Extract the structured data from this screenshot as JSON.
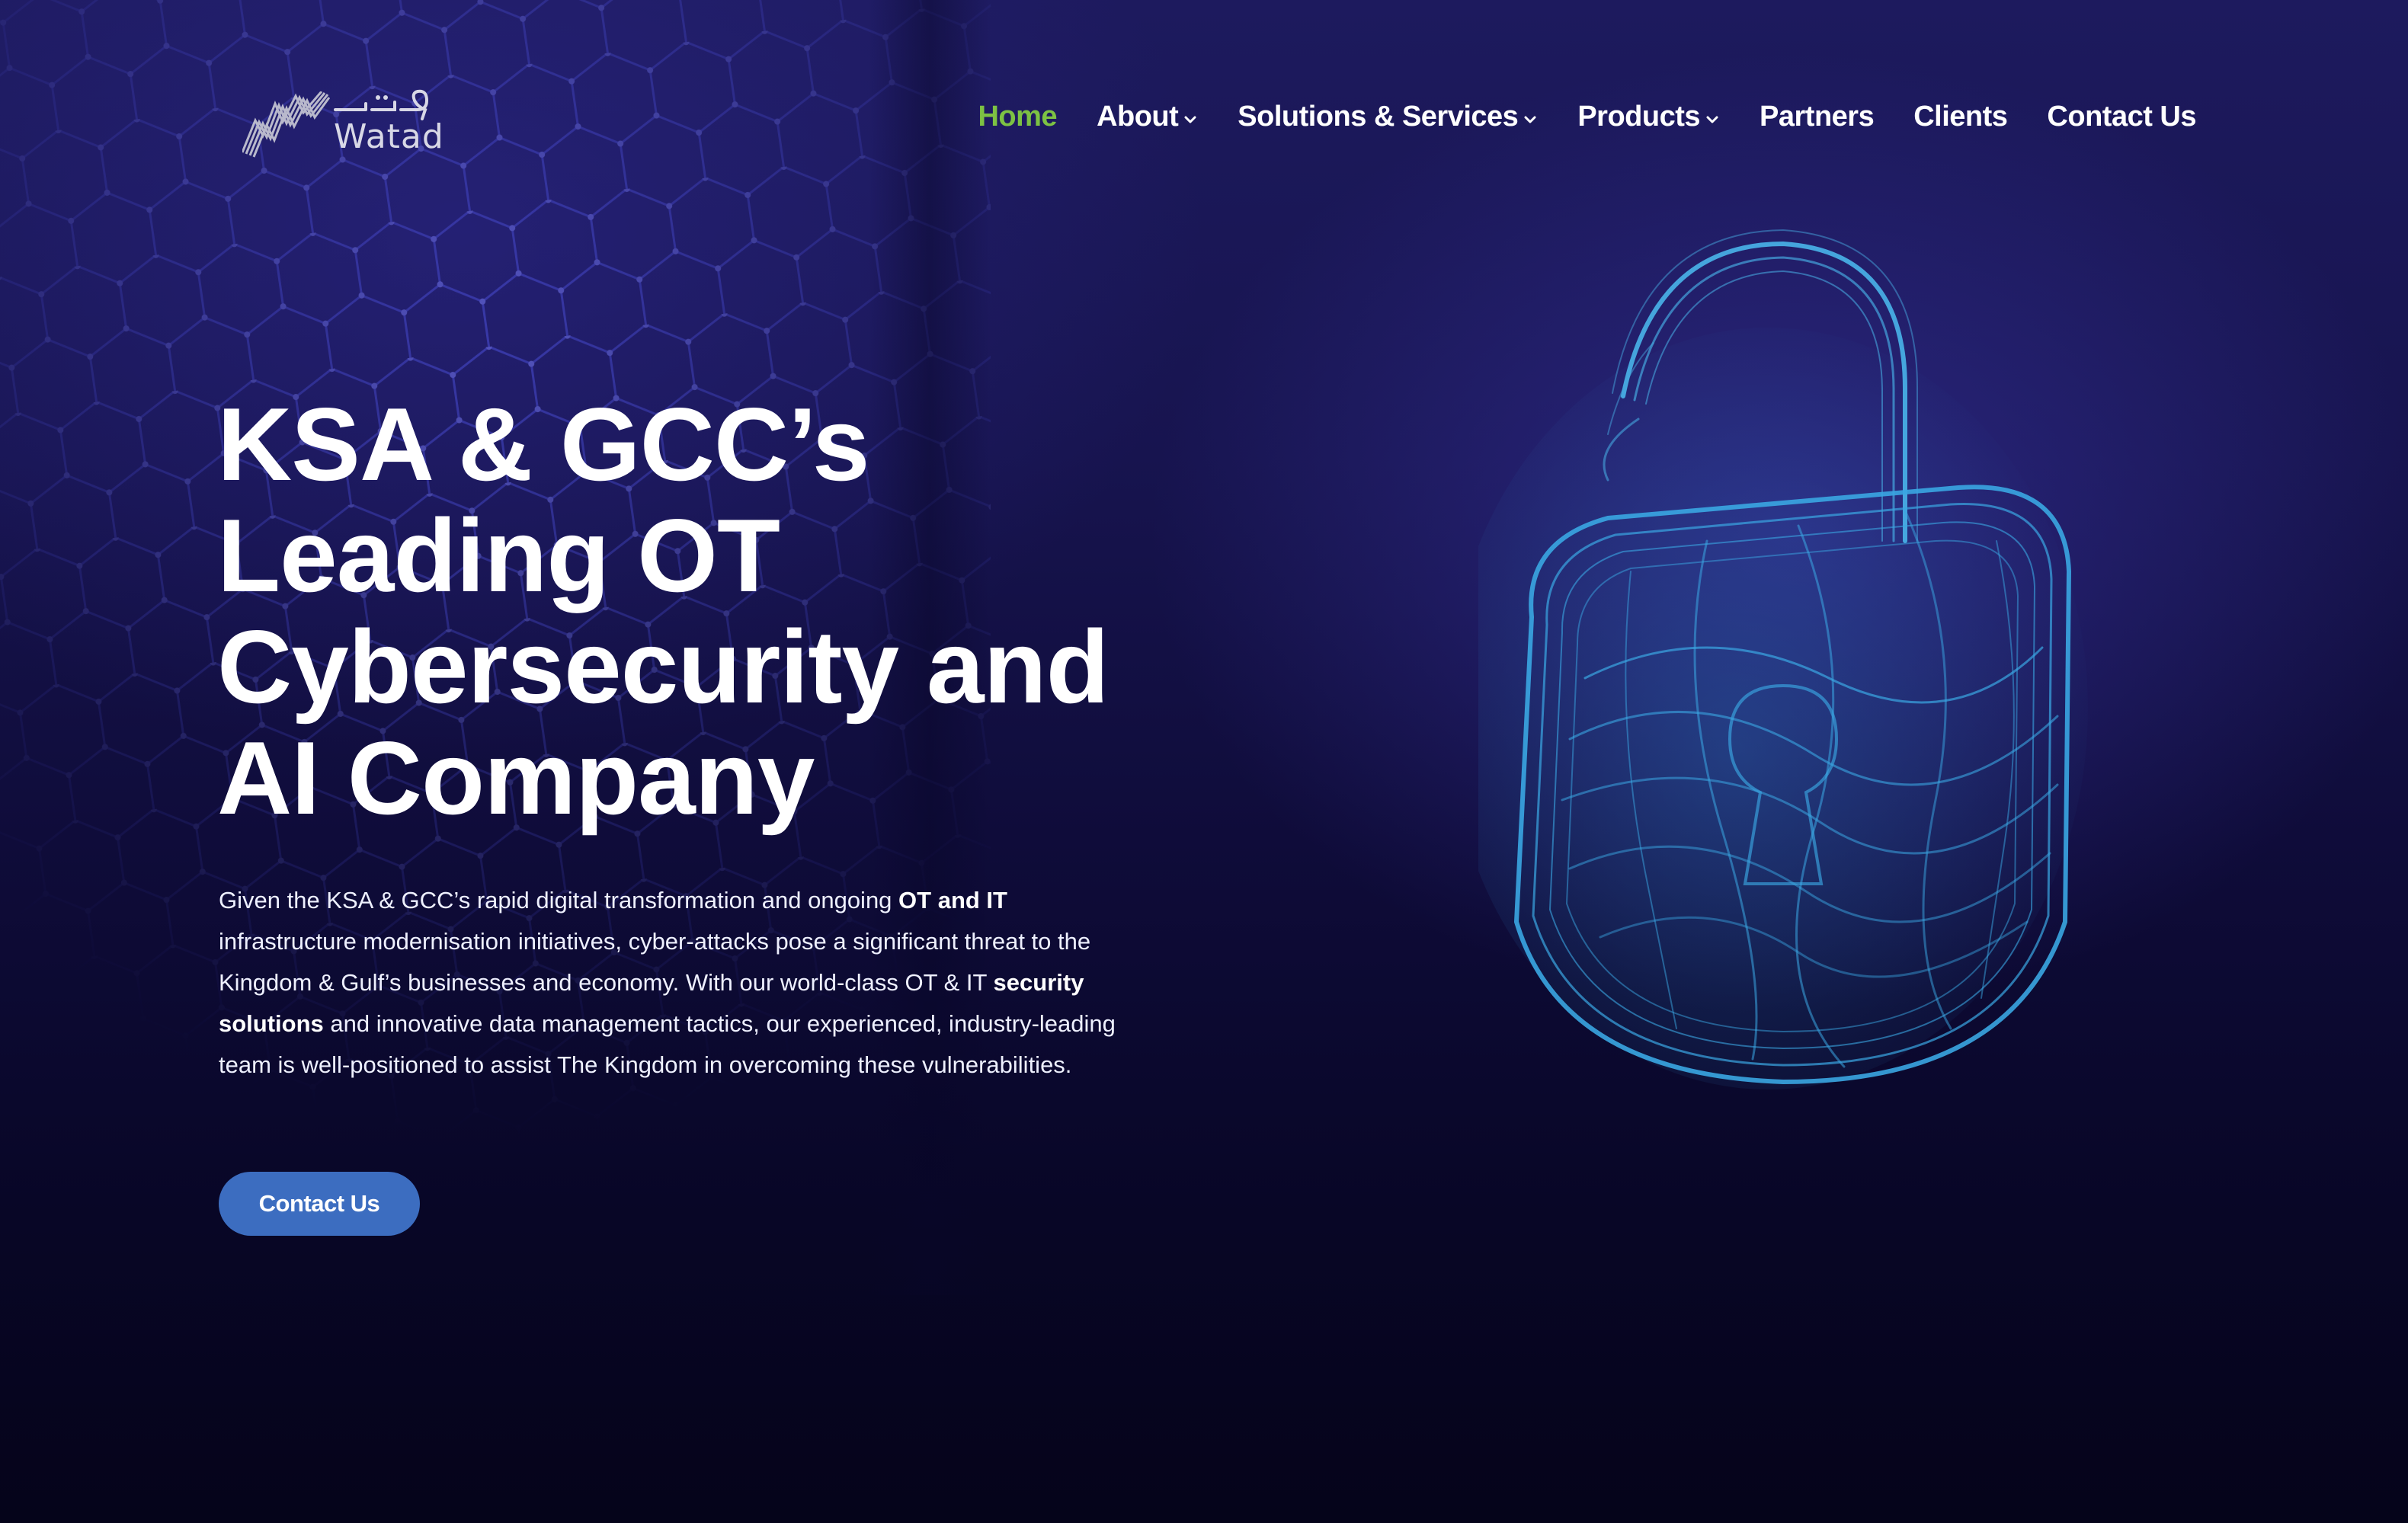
{
  "brand": {
    "logo_arabic": "وتد",
    "logo_text": "Watad"
  },
  "nav": {
    "items": [
      {
        "label": "Home",
        "active": true,
        "dropdown": false
      },
      {
        "label": "About",
        "active": false,
        "dropdown": true
      },
      {
        "label": "Solutions & Services",
        "active": false,
        "dropdown": true
      },
      {
        "label": "Products",
        "active": false,
        "dropdown": true
      },
      {
        "label": "Partners",
        "active": false,
        "dropdown": false
      },
      {
        "label": "Clients",
        "active": false,
        "dropdown": false
      },
      {
        "label": "Contact Us",
        "active": false,
        "dropdown": false
      }
    ]
  },
  "hero": {
    "title_lines": [
      "KSA & GCC’s",
      "Leading OT",
      "Cybersecurity and",
      "AI Company"
    ],
    "desc": {
      "p1": "Given the KSA & GCC’s rapid digital transformation and ongoing ",
      "b1": "OT and IT",
      "p2": " infrastructure modernisation initiatives, cyber-attacks pose a significant threat to the Kingdom & Gulf’s businesses and economy. With our world-class OT & IT ",
      "b2": "security solutions",
      "p3": " and innovative data management tactics, our experienced, industry-leading team is well-positioned to assist The Kingdom in overcoming these vulnerabilities."
    },
    "cta_label": "Contact Us"
  },
  "colors": {
    "active_nav": "#7dc243",
    "cta_bg": "#3c6dc0",
    "lock_glow": "#3fa8e0"
  },
  "icons": {
    "chevron": "chevron-down-icon",
    "lock": "padlock-illustration"
  }
}
